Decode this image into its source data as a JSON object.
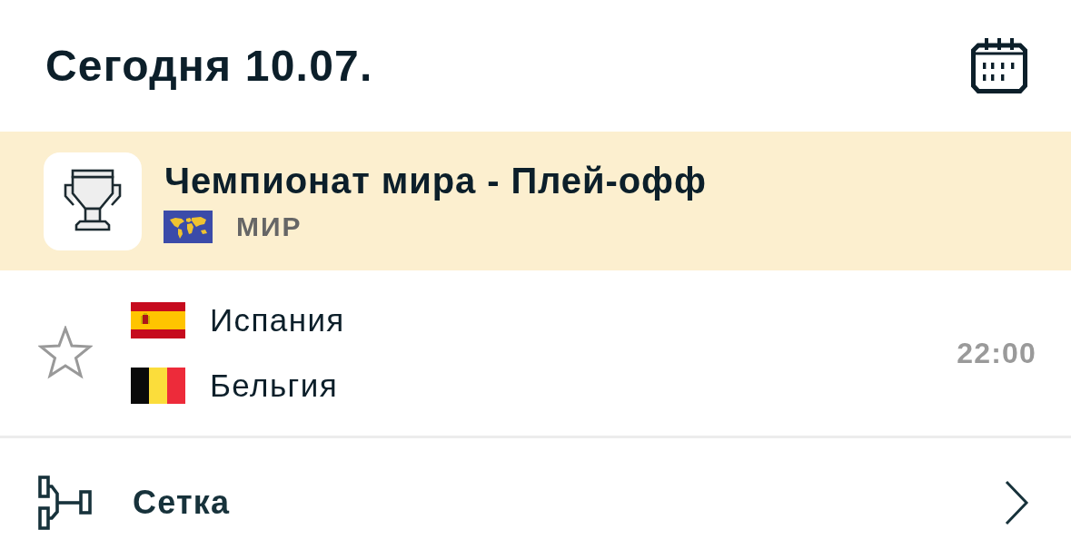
{
  "header": {
    "title": "Сегодня 10.07."
  },
  "league": {
    "name": "Чемпионат мира - Плей-офф",
    "region": "МИР"
  },
  "matches": [
    {
      "favorite": false,
      "teams": [
        {
          "name": "Испания"
        },
        {
          "name": "Бельгия"
        }
      ],
      "time": "22:00"
    }
  ],
  "links": [
    {
      "label": "Сетка"
    }
  ]
}
